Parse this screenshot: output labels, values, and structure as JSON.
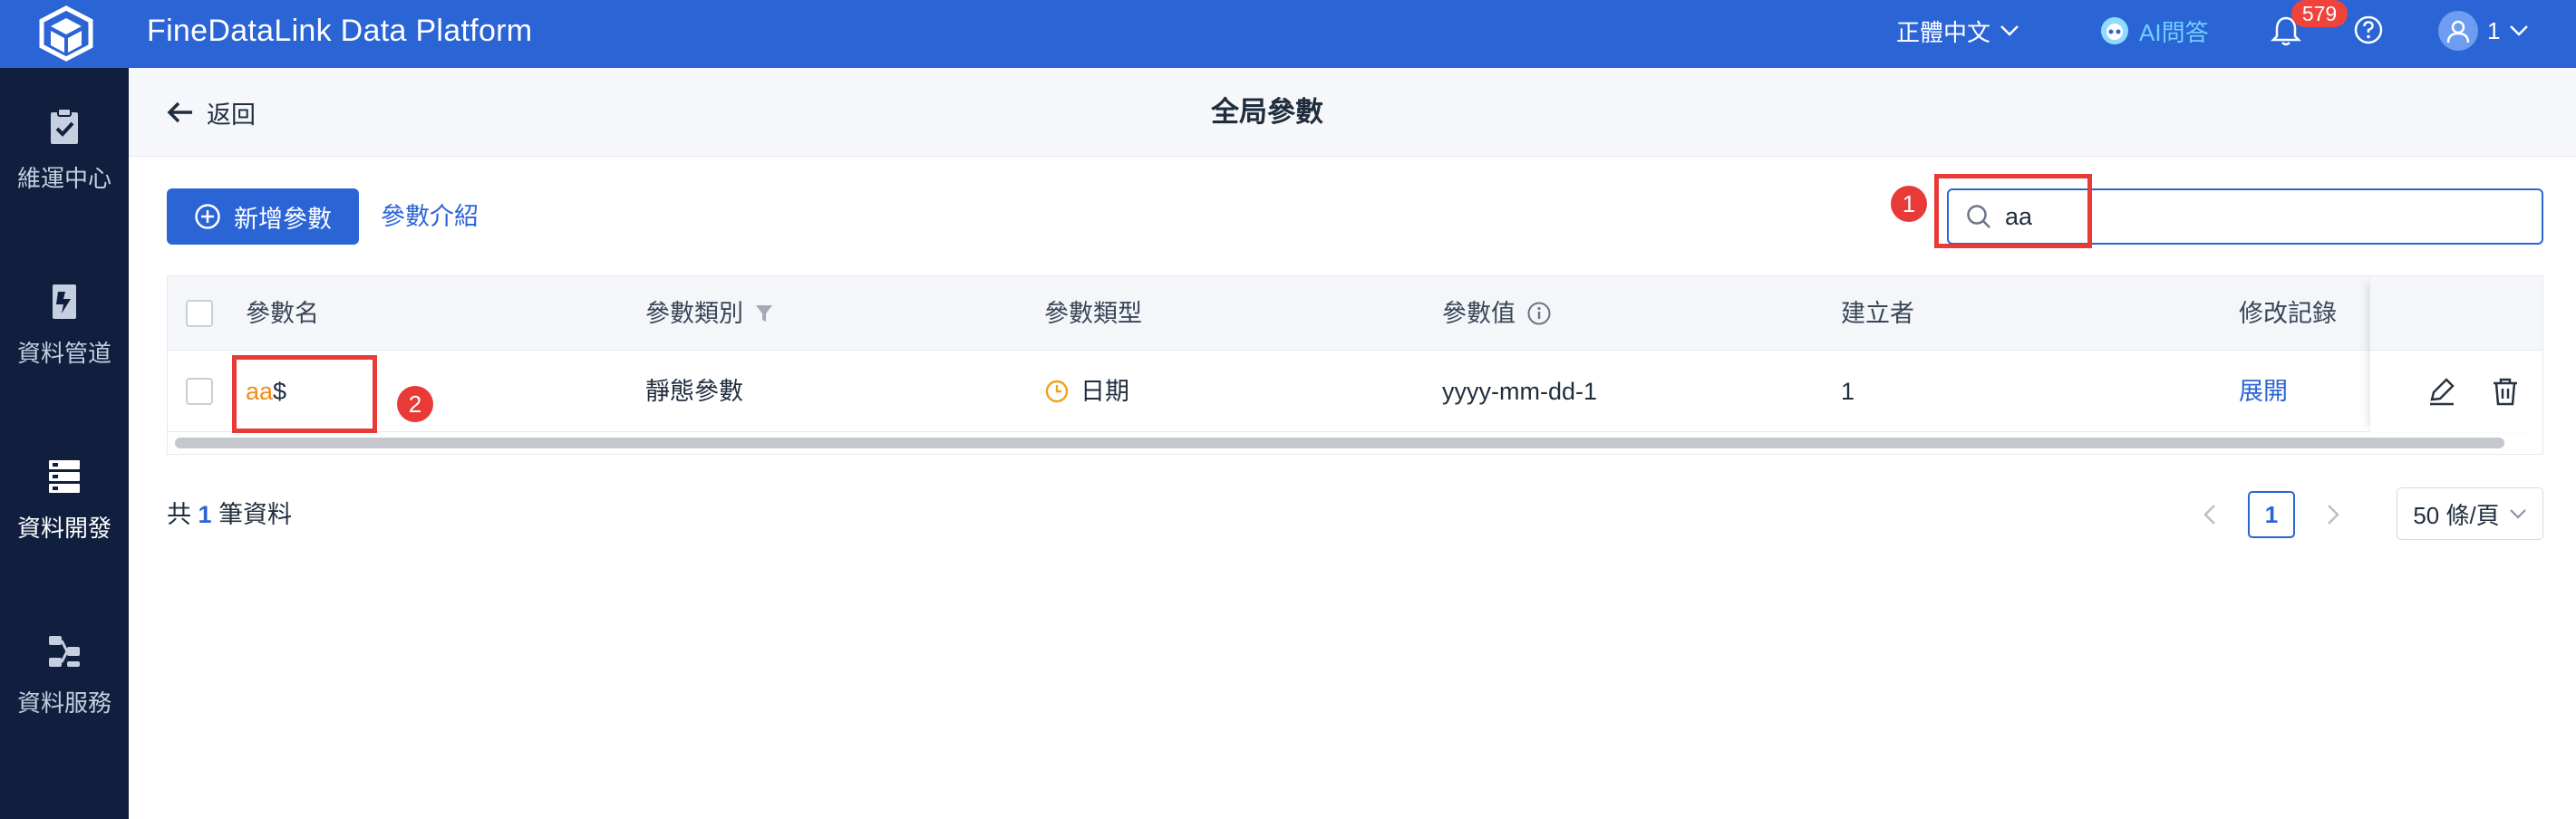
{
  "app": {
    "title": "FineDataLink Data Platform"
  },
  "topbar": {
    "language": "正體中文",
    "ai_label": "AI問答",
    "notification_count": "579",
    "user_name": "1"
  },
  "sidebar": {
    "items": [
      {
        "label": "維運中心",
        "icon": "ops-clipboard-icon",
        "active": false
      },
      {
        "label": "資料管道",
        "icon": "pipeline-icon",
        "active": false
      },
      {
        "label": "資料開發",
        "icon": "data-dev-icon",
        "active": true
      },
      {
        "label": "資料服務",
        "icon": "data-service-icon",
        "active": false
      }
    ]
  },
  "header": {
    "back_label": "返回",
    "title": "全局參數"
  },
  "toolbar": {
    "add_label": "新增參數",
    "intro_link": "參數介紹",
    "search_value": "aa"
  },
  "annotations": {
    "one": "1",
    "two": "2"
  },
  "table": {
    "columns": {
      "name": "參數名",
      "category": "參數類別",
      "type": "參數類型",
      "value": "參數值",
      "creator": "建立者",
      "history": "修改記錄"
    },
    "rows": [
      {
        "name_match": "aa",
        "name_rest": "$",
        "category": "靜態參數",
        "type": "日期",
        "value": "yyyy-mm-dd-1",
        "creator": "1",
        "history": "展開"
      }
    ]
  },
  "footer": {
    "total_prefix": "共",
    "total_count": "1",
    "total_suffix": "筆資料",
    "current_page": "1",
    "page_size": "50 條/頁"
  },
  "colors": {
    "primary": "#2b64d5",
    "sidebar": "#0f1f3d",
    "highlight": "#f08c1a",
    "annotation": "#e83a36"
  }
}
